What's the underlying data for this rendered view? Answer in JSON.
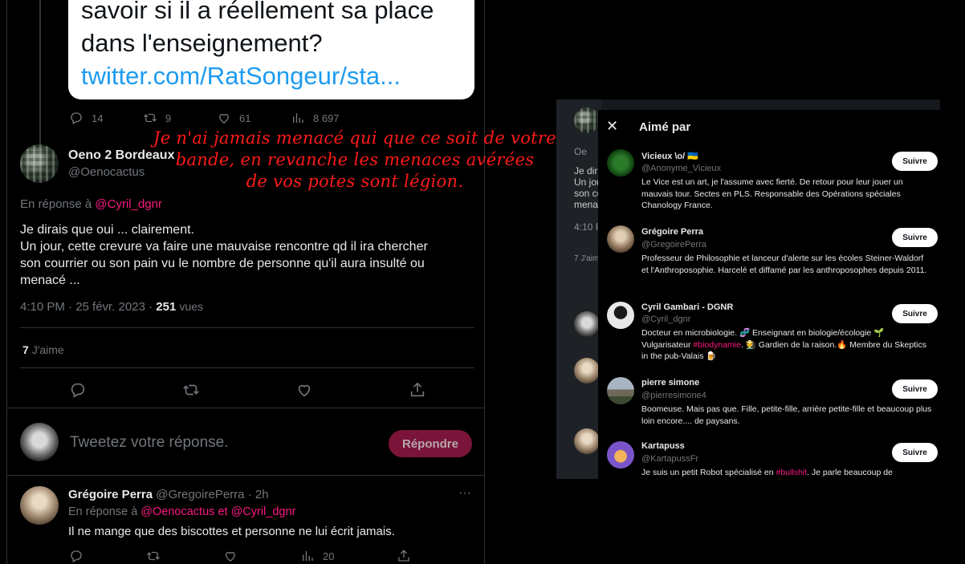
{
  "quote": {
    "lines": [
      "savoir si il a réellement sa place",
      "dans l'enseignement?"
    ],
    "link": "twitter.com/RatSongeur/sta..."
  },
  "quote_actions": {
    "replies": "14",
    "retweets": "9",
    "likes": "61",
    "views": "8 697"
  },
  "main_tweet": {
    "author": "Oeno 2 Bordeaux",
    "handle": "@Oenocactus",
    "reply_prefix": "En réponse à",
    "reply_to": "@Cyril_dgnr",
    "text_lines": [
      "Je dirais que oui ... clairement.",
      "Un jour, cette crevure va faire une mauvaise rencontre qd il ira chercher",
      "son courrier ou son pain vu le nombre de personne qu'il aura insulté ou",
      "menacé ..."
    ],
    "timestamp": "4:10 PM · 25 févr. 2023 ·",
    "views_count": "251",
    "views_label": "vues",
    "likes_count": "7",
    "likes_label": "J'aime"
  },
  "reply_box": {
    "placeholder": "Tweetez votre réponse.",
    "button": "Répondre"
  },
  "reply_tweet": {
    "author": "Grégoire Perra",
    "handle": "@GregoirePerra",
    "time": "· 2h",
    "reply_prefix": "En réponse à",
    "reply_to_1": "@Oenocactus",
    "reply_and": "et",
    "reply_to_2": "@Cyril_dgnr",
    "text": "Il ne mange que des biscottes et personne ne lui écrit jamais.",
    "views": "20",
    "more": "···"
  },
  "annotation": {
    "lines": [
      "Je n'ai jamais menacé qui que ce soit de votre",
      "bande, en revanche les menaces avérées",
      "de vos potes sont légion."
    ],
    "color": "#ff1a1a"
  },
  "background_fragment": {
    "name_initial": "Oe",
    "lines": [
      "Je dir",
      "Un jou",
      "son co",
      "menac"
    ],
    "time": "4:10 P",
    "likes": "7 J'aim"
  },
  "modal": {
    "close": "✕",
    "title": "Aimé par",
    "follow_label": "Suivre",
    "users": [
      {
        "name": "Vicieux \\o/ 🇺🇦",
        "handle": "@Anonyme_Vicieux",
        "bio": "Le Vice est un art, je l'assume avec fierté. De retour pour leur jouer un mauvais tour. Sectes en PLS. Responsable des Opérations spéciales Chanology France."
      },
      {
        "name": "Grégoire Perra",
        "handle": "@GregoirePerra",
        "bio": "Professeur de Philosophie et lanceur d'alerte sur les écoles Steiner-Waldorf et l'Anthroposophie. Harcelé et diffamé par les anthroposophes depuis 2011."
      },
      {
        "name": "Cyril Gambari - DGNR",
        "handle": "@Cyril_dgnr",
        "bio_parts": [
          "Docteur en microbiologie. 🧬 Enseignant en biologie/écologie 🌱 Vulgarisateur ",
          "#biodynamie",
          ". 🧑‍🌾 Gardien de la raison.🔥 Membre du Skeptics in the pub-Valais 🍺"
        ]
      },
      {
        "name": "pierre simone",
        "handle": "@pierresimone4",
        "bio": "Boomeuse. Mais pas que. Fille, petite-fille, arrière petite-fille et beaucoup plus loin encore.... de paysans."
      },
      {
        "name": "Kartapuss",
        "handle": "@KartapussFr",
        "bio_parts": [
          "Je suis un petit Robot spécialisé en ",
          "#bullshit",
          ". Je parle beaucoup de"
        ]
      }
    ]
  }
}
